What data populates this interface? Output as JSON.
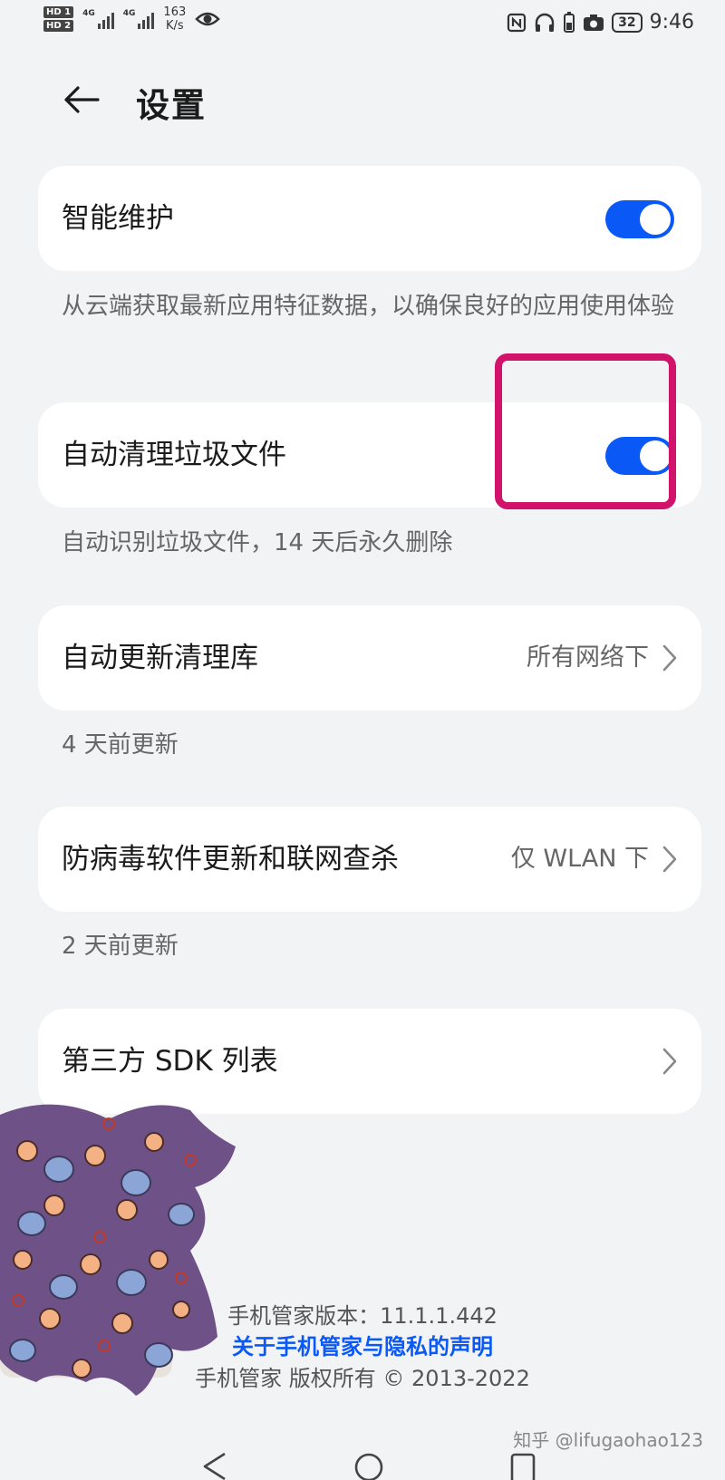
{
  "status_bar": {
    "hd1": "HD 1",
    "hd2": "HD 2",
    "net1": "4G",
    "net2": "4G",
    "speed_value": "163",
    "speed_unit": "K/s",
    "battery": "32",
    "time": "9:46"
  },
  "header": {
    "title": "设置"
  },
  "settings": [
    {
      "label": "智能维护",
      "control": "toggle",
      "on": true,
      "desc": "从云端获取最新应用特征数据，以确保良好的应用使用体验"
    },
    {
      "label": "自动清理垃圾文件",
      "control": "toggle",
      "on": true,
      "desc": "自动识别垃圾文件，14 天后永久删除"
    },
    {
      "label": "自动更新清理库",
      "control": "value",
      "value": "所有网络下",
      "desc": "4 天前更新"
    },
    {
      "label": "防病毒软件更新和联网查杀",
      "control": "value",
      "value": "仅 WLAN 下",
      "desc": "2 天前更新"
    },
    {
      "label": "第三方 SDK 列表",
      "control": "chevron"
    }
  ],
  "footer": {
    "version": "手机管家版本：11.1.1.442",
    "privacy_link": "关于手机管家与隐私的声明",
    "copyright": "手机管家 版权所有 © 2013-2022"
  },
  "watermark": "知乎 @lifugaohao123",
  "colors": {
    "accent": "#0a59f7",
    "highlight_box": "#d1136b",
    "background": "#f1f3f5"
  }
}
